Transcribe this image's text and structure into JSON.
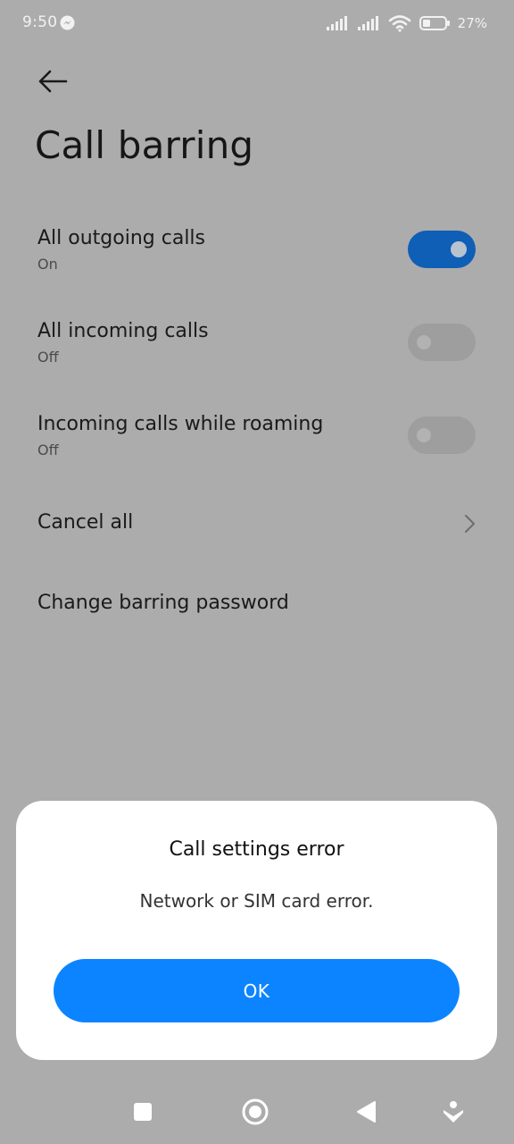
{
  "status_bar": {
    "time": "9:50",
    "battery": "27%",
    "icons": [
      "messenger-icon",
      "signal-sim1-icon",
      "signal-sim2-icon",
      "wifi-icon",
      "battery-icon"
    ]
  },
  "header": {
    "back_icon": "arrow-left-icon",
    "title": "Call barring"
  },
  "settings": [
    {
      "title": "All outgoing calls",
      "subtitle": "On",
      "toggle": "on"
    },
    {
      "title": "All incoming calls",
      "subtitle": "Off",
      "toggle": "off"
    },
    {
      "title": "Incoming calls while roaming",
      "subtitle": "Off",
      "toggle": "off"
    }
  ],
  "actions": {
    "cancel_all": "Cancel all",
    "change_password": "Change barring password"
  },
  "dialog": {
    "title": "Call settings error",
    "message": "Network or SIM card error.",
    "ok_label": "OK"
  },
  "nav": {
    "icons": [
      "recents-square-icon",
      "home-circle-icon",
      "back-triangle-icon",
      "assistant-icon"
    ]
  },
  "colors": {
    "toggle_on": "#0e5fb5",
    "dialog_button": "#0d84ff",
    "screen_dim": "#acacac"
  }
}
